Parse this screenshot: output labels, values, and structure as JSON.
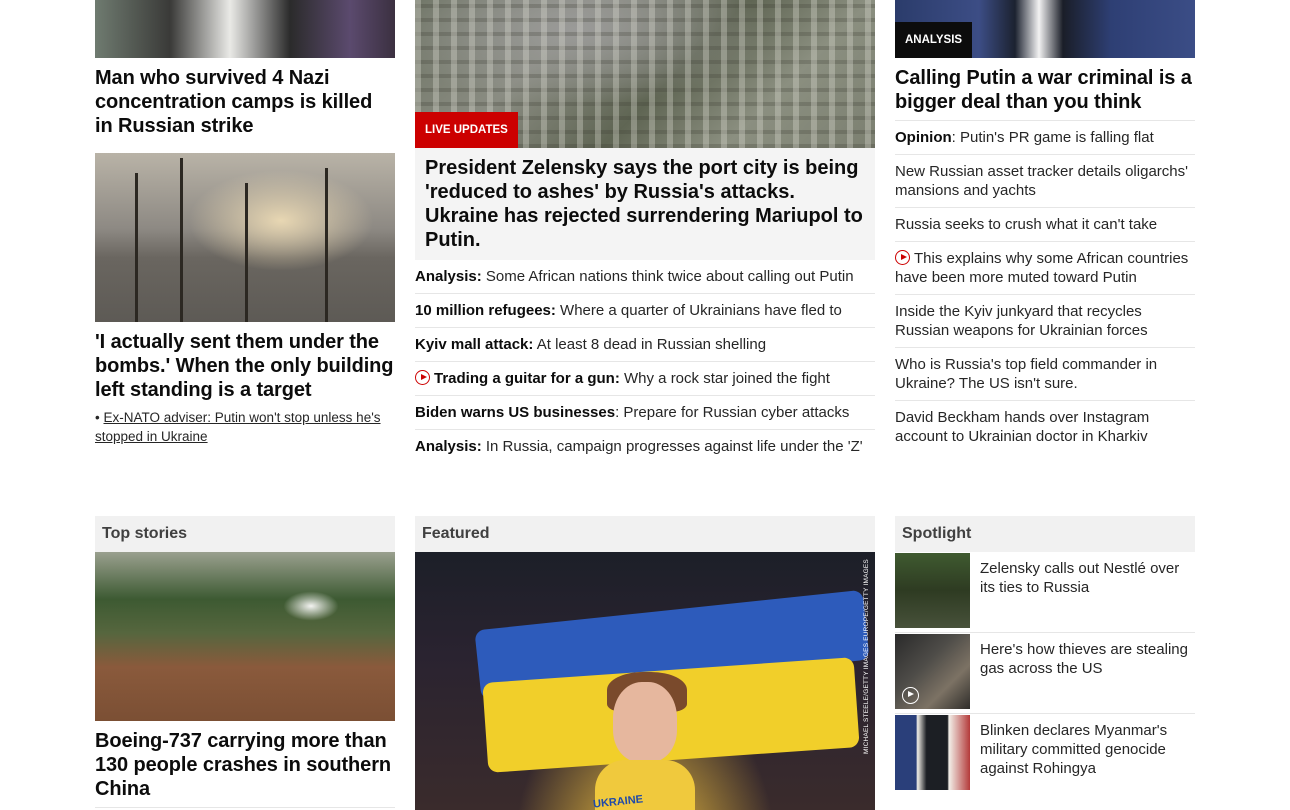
{
  "left": {
    "story1": {
      "headline": "Man who survived 4 Nazi concentration camps is killed in Russian strike"
    },
    "story2": {
      "headline": "'I actually sent them under the bombs.' When the only building left standing is a target",
      "sub_bullet": "•",
      "sub_link": "Ex-NATO adviser: Putin won't stop unless he's stopped in Ukraine"
    }
  },
  "middle": {
    "badge": "LIVE UPDATES",
    "headline": "President Zelensky says the port city is being 'reduced to ashes' by Russia's attacks. Ukraine has rejected surrendering Mariupol to Putin.",
    "items": [
      {
        "bold": "Analysis:",
        "text": " Some African nations think twice about calling out Putin"
      },
      {
        "bold": "10 million refugees:",
        "text": " Where a quarter of Ukrainians have fled to"
      },
      {
        "bold": "Kyiv mall attack:",
        "text": " At least 8 dead in Russian shelling"
      },
      {
        "bold": "Trading a guitar for a gun:",
        "text": " Why a rock star joined the fight",
        "icon": "play-icon"
      },
      {
        "bold": "Biden warns US businesses",
        "text": ": Prepare for Russian cyber attacks"
      },
      {
        "bold": "Analysis:",
        "text": " In Russia, campaign progresses against life under the 'Z'"
      }
    ]
  },
  "right": {
    "badge": "ANALYSIS",
    "headline": "Calling Putin a war criminal is a bigger deal than you think",
    "items": [
      {
        "bold": "Opinion",
        "text": ": Putin's PR game is falling flat"
      },
      {
        "bold": "",
        "text": "New Russian asset tracker details oligarchs' mansions and yachts"
      },
      {
        "bold": "",
        "text": "Russia seeks to crush what it can't take"
      },
      {
        "bold": "",
        "text": "This explains why some African countries have been more muted toward Putin",
        "icon": "play-icon"
      },
      {
        "bold": "",
        "text": "Inside the Kyiv junkyard that recycles Russian weapons for Ukrainian forces"
      },
      {
        "bold": "",
        "text": "Who is Russia's top field commander in Ukraine? The US isn't sure."
      },
      {
        "bold": "",
        "text": "David Beckham hands over Instagram account to Ukrainian doctor in Kharkiv"
      }
    ]
  },
  "top_stories": {
    "title": "Top stories",
    "headline": "Boeing-737 carrying more than 130 people crashes in southern China"
  },
  "featured": {
    "title": "Featured",
    "photo_credit": "MICHAEL STEELE/GETTY IMAGES EUROPE/GETTY IMAGES",
    "shirt_text": "UKRAINE"
  },
  "spotlight": {
    "title": "Spotlight",
    "items": [
      {
        "text": "Zelensky calls out Nestlé over its ties to Russia",
        "thumb": "zelensky-photo"
      },
      {
        "text": "Here's how thieves are stealing gas across the US",
        "thumb": "gas-theft-video",
        "icon": "play-icon"
      },
      {
        "text": "Blinken declares Myanmar's military committed genocide against Rohingya",
        "thumb": "blinken-photo"
      }
    ]
  },
  "colors": {
    "live_red": "#cc0000",
    "analysis_black": "#0c0c0c",
    "section_bg": "#f1f1f1"
  }
}
